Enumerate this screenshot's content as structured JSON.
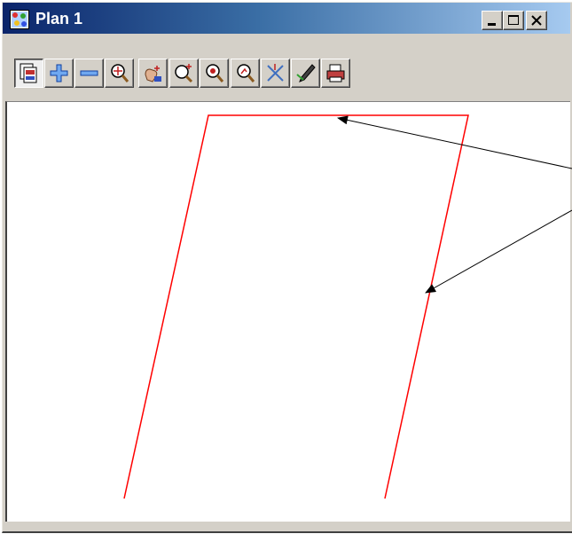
{
  "window": {
    "title": "Plan 1",
    "app_icon": "plan-view-icon"
  },
  "caption_buttons": [
    "minimize-icon",
    "maximize-icon",
    "close-icon"
  ],
  "toolbar": {
    "buttons": [
      {
        "name": "plot-view-button",
        "icon": "plot-view-icon"
      },
      {
        "name": "zoom-in-button",
        "icon": "plus-icon"
      },
      {
        "name": "zoom-out-button",
        "icon": "minus-icon"
      },
      {
        "name": "zoom-extents-button",
        "icon": "zoom-extents-icon"
      },
      {
        "name": "pan-button",
        "icon": "hand-pan-icon"
      },
      {
        "name": "zoom-window-button",
        "icon": "zoom-window-icon"
      },
      {
        "name": "zoom-centre-button",
        "icon": "zoom-centre-icon"
      },
      {
        "name": "zoom-previous-button",
        "icon": "zoom-previous-icon"
      },
      {
        "name": "cursor-button",
        "icon": "cross-cursor-icon"
      },
      {
        "name": "pick-button",
        "icon": "pick-pen-icon"
      },
      {
        "name": "print-button",
        "icon": "printer-icon"
      }
    ]
  },
  "canvas": {
    "line_color": "#ff0000",
    "annotation_color": "#000000"
  },
  "colors": {
    "titlebar_start": "#0a246a",
    "titlebar_end": "#a6caf0",
    "chrome": "#d4d0c8"
  }
}
